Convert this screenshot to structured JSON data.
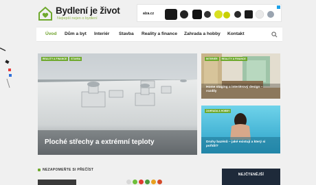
{
  "header": {
    "logo_title": "Bydlení je život",
    "logo_subtitle": "Nejlepší nejen o bydlení",
    "ad_brand": "alza.cz"
  },
  "nav": {
    "items": [
      {
        "label": "Úvod",
        "active": true
      },
      {
        "label": "Dům a byt",
        "active": false
      },
      {
        "label": "Interiér",
        "active": false
      },
      {
        "label": "Stavba",
        "active": false
      },
      {
        "label": "Reality a finance",
        "active": false
      },
      {
        "label": "Zahrada a hobby",
        "active": false
      },
      {
        "label": "Kontakt",
        "active": false
      }
    ]
  },
  "articles": {
    "main": {
      "tags": [
        "REALITY A FINANCE",
        "STAVBA"
      ],
      "title": "Ploché střechy a extrémní teploty"
    },
    "side_top": {
      "tags": [
        "INTERIÉR",
        "REALITY A FINANCE"
      ],
      "title": "Home staging a interiérový design – rozdíly"
    },
    "side_bottom": {
      "tags": [
        "ZAHRADA A HOBBY"
      ],
      "title": "Druhy bazénů – jaké existují a který si pořídit?"
    }
  },
  "sections": {
    "dont_miss": "NEZAPOMEŇTE SI PŘEČÍST",
    "most_read": "NEJČTENĚJŠÍ"
  },
  "colors": {
    "accent": "#6fa92e",
    "nav_active": "#6ca12a",
    "dark_box": "#1e2a3a"
  }
}
